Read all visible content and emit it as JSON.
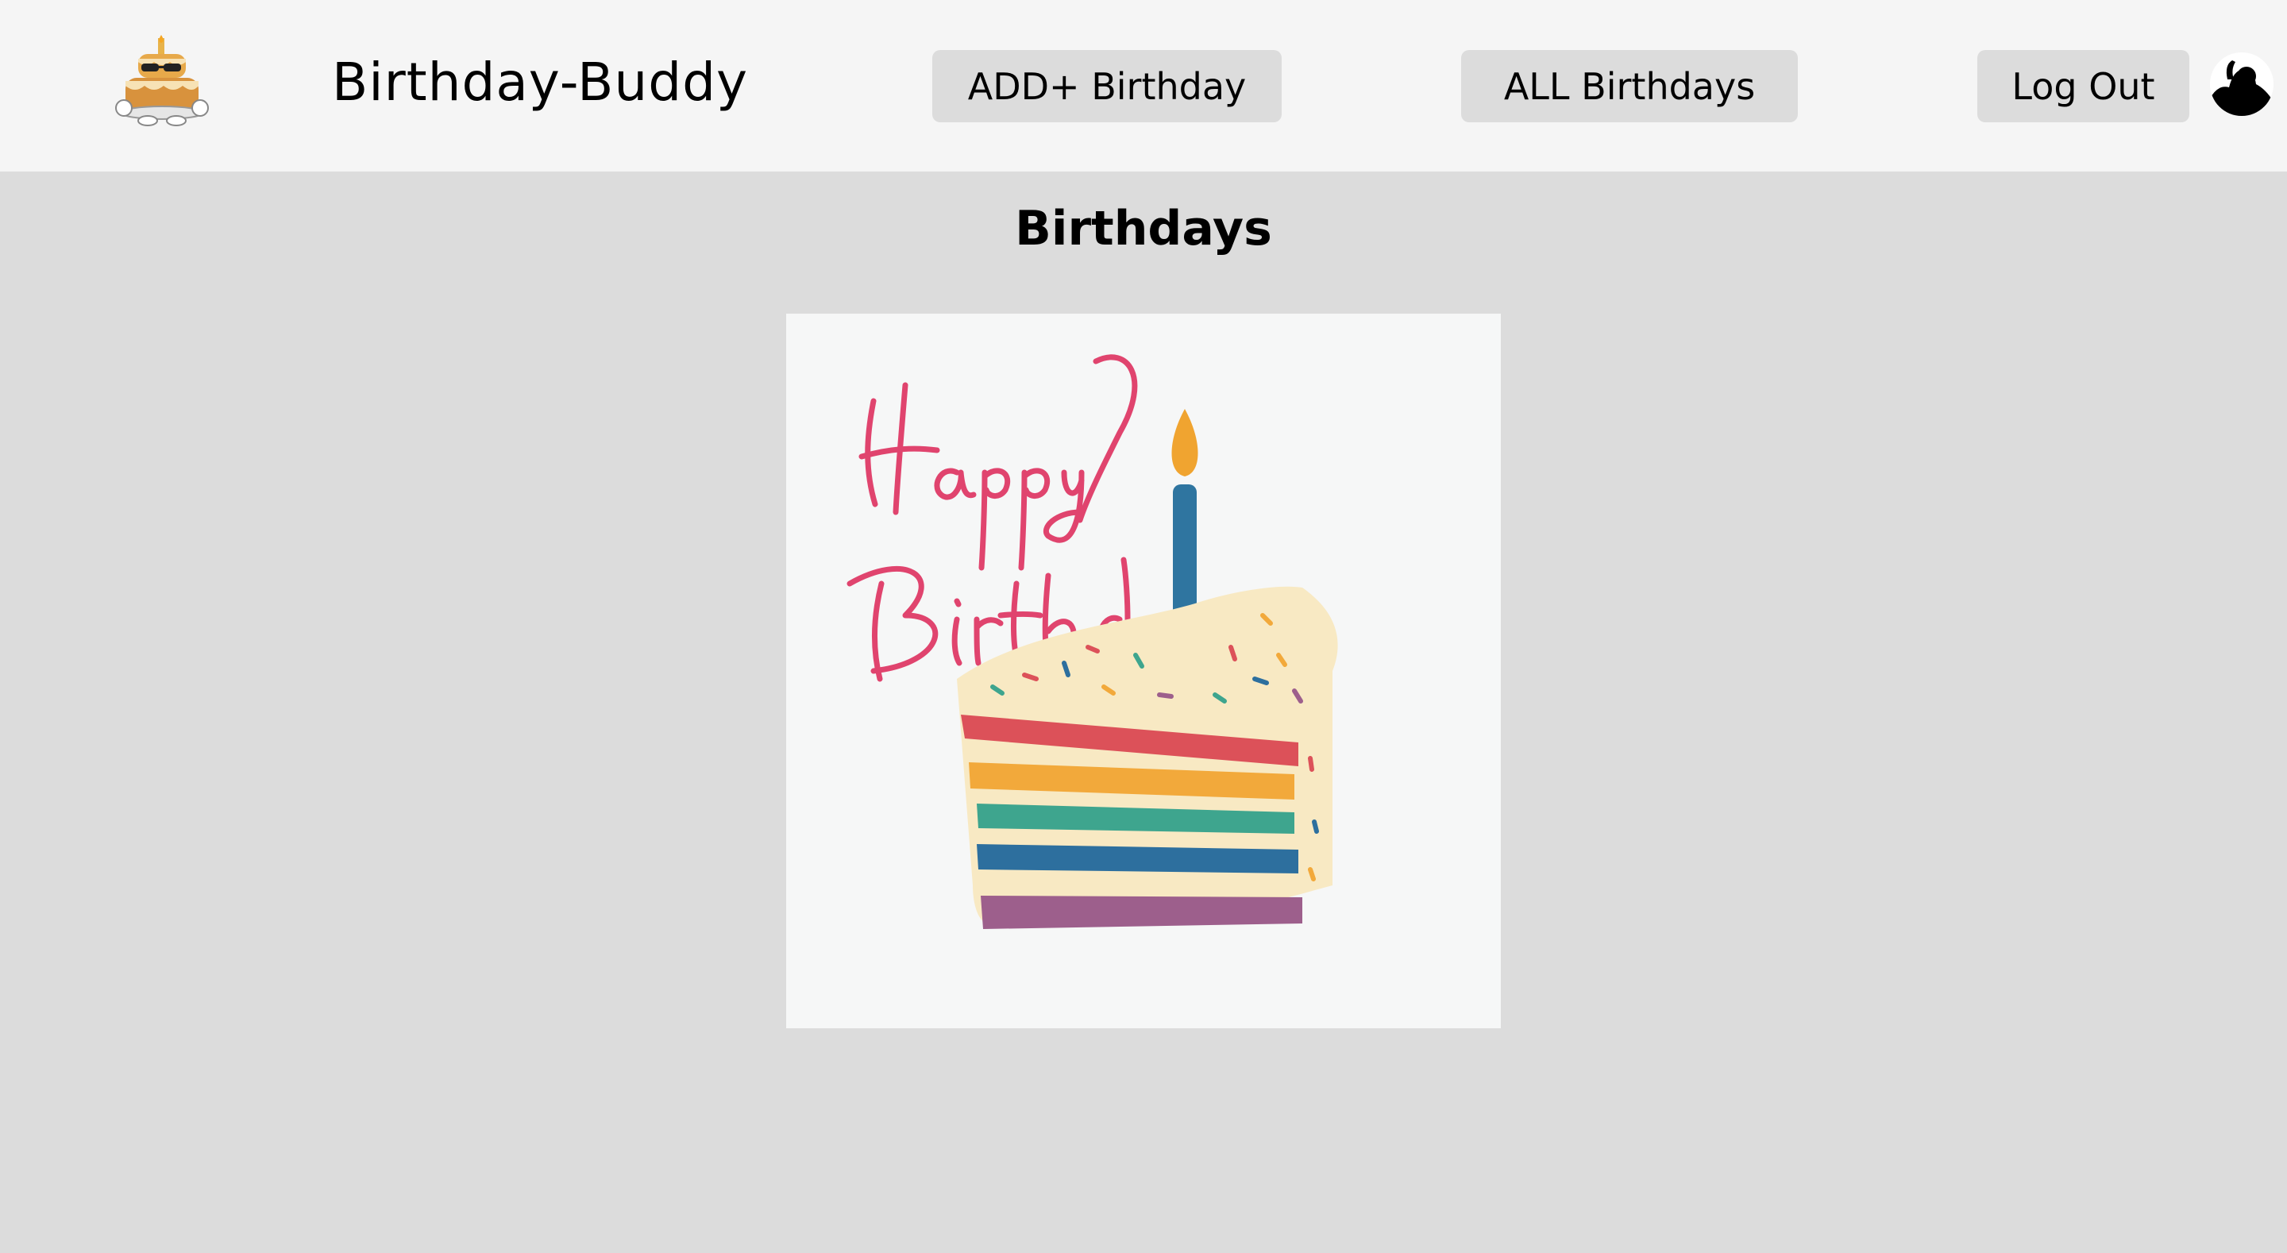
{
  "header": {
    "app_title": "Birthday-Buddy",
    "logo_icon": "cake-mascot-icon",
    "nav": {
      "add_label": "ADD+ Birthday",
      "all_label": "ALL Birthdays",
      "logout_label": "Log Out"
    },
    "avatar_icon": "user-avatar-icon"
  },
  "main": {
    "page_title": "Birthdays",
    "card": {
      "image_icon": "birthday-cake-slice-illustration",
      "image_text": "Happy Birthday"
    }
  },
  "colors": {
    "header_bg": "#f5f5f5",
    "page_bg": "#dcdcdc",
    "button_bg": "#dcdcdc",
    "card_bg": "#f6f7f7",
    "script_pink": "#e0446e",
    "candle_blue": "#2f75a0",
    "flame_orange": "#f0a430",
    "cake_cream": "#f8e9c3",
    "layer_red": "#dc5159",
    "layer_orange": "#f2a93b",
    "layer_teal": "#3ea58e",
    "layer_blue": "#2d6f9e",
    "layer_purple": "#9d5f8c"
  }
}
